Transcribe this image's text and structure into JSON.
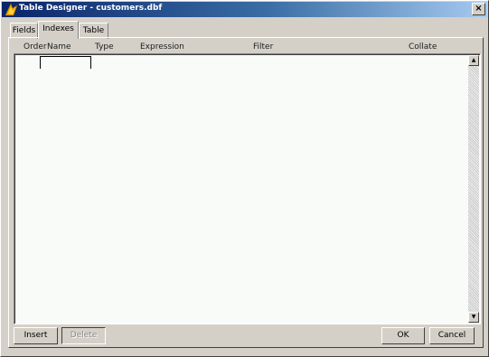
{
  "window": {
    "title": "Table Designer - customers.dbf",
    "close_label": "×",
    "icon": "app-icon"
  },
  "tabs": [
    {
      "label": "Fields",
      "active": false
    },
    {
      "label": "Indexes",
      "active": true
    },
    {
      "label": "Table",
      "active": false
    }
  ],
  "columns": [
    "Order",
    "Name",
    "Type",
    "Expression",
    "Filter",
    "Collate"
  ],
  "scrollbar": {
    "up_icon": "▲",
    "down_icon": "▼"
  },
  "buttons": {
    "insert": "Insert",
    "delete": "Delete",
    "ok": "OK",
    "cancel": "Cancel"
  }
}
